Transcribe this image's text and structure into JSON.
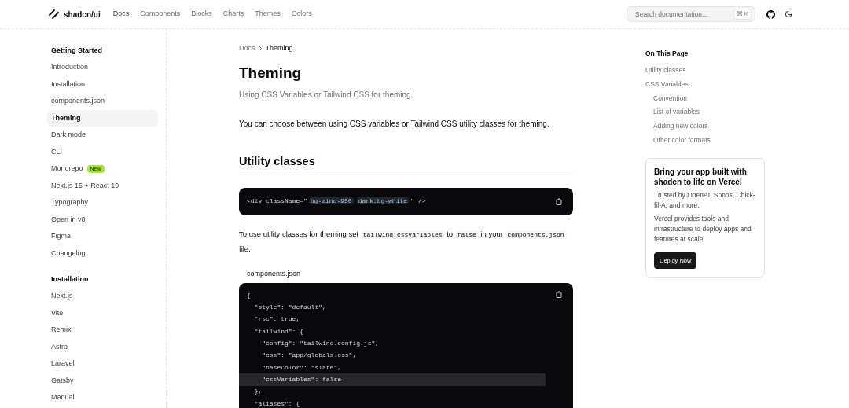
{
  "header": {
    "logo": "shadcn/ui",
    "nav": [
      {
        "label": "Docs",
        "selected": true
      },
      {
        "label": "Components",
        "selected": false
      },
      {
        "label": "Blocks",
        "selected": false
      },
      {
        "label": "Charts",
        "selected": false
      },
      {
        "label": "Themes",
        "selected": false
      },
      {
        "label": "Colors",
        "selected": false
      }
    ],
    "search": {
      "placeholder": "Search documentation...",
      "shortcut": [
        "⌘",
        "K"
      ]
    }
  },
  "sidebar": {
    "sections": [
      {
        "title": "Getting Started",
        "items": [
          {
            "label": "Introduction",
            "selected": false
          },
          {
            "label": "Installation",
            "selected": false
          },
          {
            "label": "components.json",
            "selected": false
          },
          {
            "label": "Theming",
            "selected": true
          },
          {
            "label": "Dark mode",
            "selected": false
          },
          {
            "label": "CLI",
            "selected": false
          },
          {
            "label": "Monorepo",
            "selected": false,
            "badge": "New"
          },
          {
            "label": "Next.js 15 + React 19",
            "selected": false
          },
          {
            "label": "Typography",
            "selected": false
          },
          {
            "label": "Open in v0",
            "selected": false
          },
          {
            "label": "Figma",
            "selected": false
          },
          {
            "label": "Changelog",
            "selected": false
          }
        ]
      },
      {
        "title": "Installation",
        "items": [
          {
            "label": "Next.js",
            "selected": false
          },
          {
            "label": "Vite",
            "selected": false
          },
          {
            "label": "Remix",
            "selected": false
          },
          {
            "label": "Astro",
            "selected": false
          },
          {
            "label": "Laravel",
            "selected": false
          },
          {
            "label": "Gatsby",
            "selected": false
          },
          {
            "label": "Manual",
            "selected": false
          }
        ]
      }
    ]
  },
  "main": {
    "breadcrumb": [
      "Docs",
      "Theming"
    ],
    "title": "Theming",
    "subtitle": "Using CSS Variables or Tailwind CSS for theming.",
    "intro": "You can choose between using CSS variables or Tailwind CSS utility classes for theming.",
    "section_title": "Utility classes",
    "snippet": [
      {
        "text": "<div className=\"",
        "kind": "plain"
      },
      {
        "text": "bg-zinc-950",
        "kind": "mark"
      },
      {
        "text": "dark:bg-white",
        "kind": "mark"
      },
      {
        "text": "\" />",
        "kind": "plain"
      }
    ],
    "paragraph": [
      {
        "text": "To use utility classes for theming set ",
        "kind": "text"
      },
      {
        "text": "tailwind.cssVariables",
        "kind": "code"
      },
      {
        "text": " to ",
        "kind": "text"
      },
      {
        "text": "false",
        "kind": "code"
      },
      {
        "text": " in your ",
        "kind": "text"
      },
      {
        "text": "components.json",
        "kind": "code"
      },
      {
        "text": " file.",
        "kind": "text"
      }
    ],
    "file_name": "components.json",
    "code_lines": [
      {
        "text": "{",
        "highlighted": false
      },
      {
        "text": "  \"style\": \"default\",",
        "highlighted": false
      },
      {
        "text": "  \"rsc\": true,",
        "highlighted": false
      },
      {
        "text": "  \"tailwind\": {",
        "highlighted": false
      },
      {
        "text": "    \"config\": \"tailwind.config.js\",",
        "highlighted": false
      },
      {
        "text": "    \"css\": \"app/globals.css\",",
        "highlighted": false
      },
      {
        "text": "    \"baseColor\": \"slate\",",
        "highlighted": false
      },
      {
        "text": "    \"cssVariables\": false",
        "highlighted": true
      },
      {
        "text": "  },",
        "highlighted": false
      },
      {
        "text": "  \"aliases\": {",
        "highlighted": false
      }
    ]
  },
  "toc": {
    "title": "On This Page",
    "items": [
      {
        "label": "Utility classes"
      },
      {
        "label": "CSS Variables",
        "children": [
          {
            "label": "Convention"
          },
          {
            "label": "List of variables"
          },
          {
            "label": "Adding new colors"
          },
          {
            "label": "Other color formats"
          }
        ]
      }
    ]
  },
  "ad": {
    "title": "Bring your app built with shadcn to life on Vercel",
    "lines": [
      "Trusted by OpenAI, Sonos, Chick-fil-A, and more.",
      "Vercel provides tools and infrastructure to deploy apps and features at scale."
    ],
    "button": "Deploy Now"
  }
}
